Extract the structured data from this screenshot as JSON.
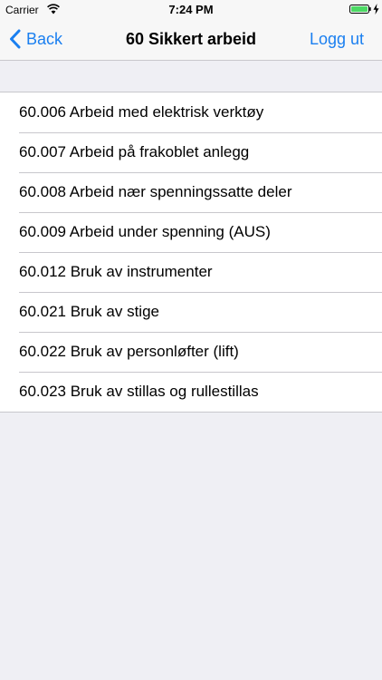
{
  "status_bar": {
    "carrier": "Carrier",
    "time": "7:24 PM",
    "battery_color": "#4cd964"
  },
  "nav": {
    "back_label": "Back",
    "title": "60 Sikkert arbeid",
    "logout_label": "Logg ut",
    "accent_color": "#1a7ff0"
  },
  "items": [
    {
      "label": "60.006 Arbeid med elektrisk verktøy"
    },
    {
      "label": "60.007 Arbeid på frakoblet anlegg"
    },
    {
      "label": "60.008 Arbeid nær spenningssatte deler"
    },
    {
      "label": "60.009 Arbeid under spenning (AUS)"
    },
    {
      "label": "60.012 Bruk av instrumenter"
    },
    {
      "label": "60.021 Bruk av stige"
    },
    {
      "label": "60.022 Bruk av personløfter (lift)"
    },
    {
      "label": "60.023 Bruk av stillas og rullestillas"
    }
  ]
}
